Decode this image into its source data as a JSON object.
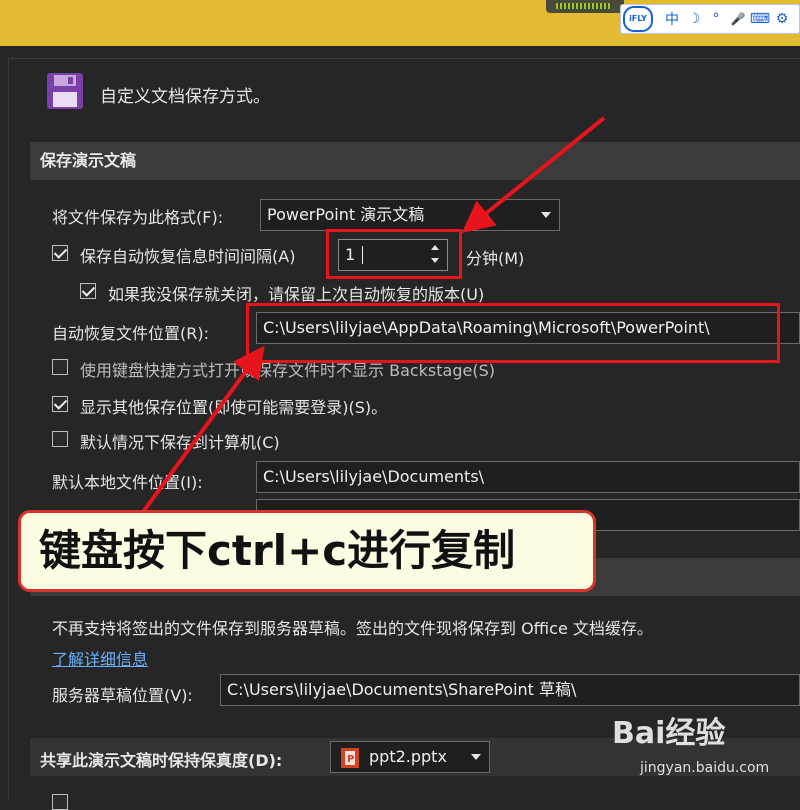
{
  "ime_toolbar": {
    "logo": "iFLY",
    "items": [
      "中",
      "☽",
      "°",
      "🎤",
      "⌨",
      "⚙"
    ]
  },
  "header": {
    "title": "自定义文档保存方式。",
    "icon": "save-disk-icon"
  },
  "section_save": {
    "heading": "保存演示文稿",
    "format_label": "将文件保存为此格式(F):",
    "format_value": "PowerPoint 演示文稿",
    "autorecover_label": "保存自动恢复信息时间间隔(A)",
    "autorecover_value": "1",
    "minutes_label": "分钟(M)",
    "keep_last_label": "如果我没保存就关闭，请保留上次自动恢复的版本(U)",
    "autorecover_path_label": "自动恢复文件位置(R):",
    "autorecover_path_value": "C:\\Users\\lilyjae\\AppData\\Roaming\\Microsoft\\PowerPoint\\",
    "backstage_label": "使用键盘快捷方式打开或保存文件时不显示 Backstage(S)",
    "show_other_label": "显示其他保存位置(即使可能需要登录)(S)。",
    "default_local_label": "默认情况下保存到计算机(C)",
    "default_local_path_label": "默认本地文件位置(I):",
    "default_local_path_value": "C:\\Users\\lilyjae\\Documents\\"
  },
  "section_offline": {
    "note": "不再支持将签出的文件保存到服务器草稿。签出的文件现将保存到 Office 文档缓存。",
    "learn_more": "了解详细信息",
    "server_drafts_label": "服务器草稿位置(V):",
    "server_drafts_value": "C:\\Users\\lilyjae\\Documents\\SharePoint 草稿\\"
  },
  "section_fidelity": {
    "heading": "共享此演示文稿时保持保真度(D):",
    "file_value": "ppt2.pptx"
  },
  "annotation": {
    "callout": "键盘按下ctrl+c进行复制"
  },
  "watermark": {
    "brand": "Bai经验",
    "url": "jingyan.baidu.com"
  },
  "colors": {
    "accent_red": "#e8141c",
    "top_bar": "#e3bb33",
    "background": "#262626"
  }
}
